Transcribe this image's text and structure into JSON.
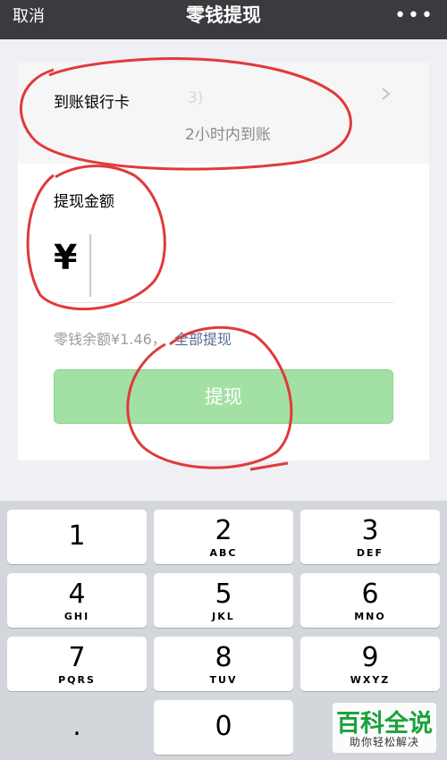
{
  "header": {
    "cancel": "取消",
    "title": "零钱提现",
    "more": "•••"
  },
  "bank": {
    "label": "到账银行卡",
    "name": "3)",
    "arrival_time": "2小时内到账"
  },
  "amount": {
    "label": "提现金额",
    "currency": "¥",
    "value": ""
  },
  "balance": {
    "text": "零钱余额¥1.46，",
    "withdraw_all": "全部提现"
  },
  "submit": {
    "label": "提现"
  },
  "keypad": {
    "keys": [
      {
        "digit": "1",
        "letters": ""
      },
      {
        "digit": "2",
        "letters": "ABC"
      },
      {
        "digit": "3",
        "letters": "DEF"
      },
      {
        "digit": "4",
        "letters": "GHI"
      },
      {
        "digit": "5",
        "letters": "JKL"
      },
      {
        "digit": "6",
        "letters": "MNO"
      },
      {
        "digit": "7",
        "letters": "PQRS"
      },
      {
        "digit": "8",
        "letters": "TUV"
      },
      {
        "digit": "9",
        "letters": "WXYZ"
      },
      {
        "digit": ".",
        "letters": ""
      },
      {
        "digit": "0",
        "letters": ""
      }
    ]
  },
  "watermark": {
    "main": "百科全说",
    "sub": "助你轻松解决"
  },
  "colors": {
    "header_bg": "#3a3a3f",
    "button_green": "#a3e0a3",
    "link_blue": "#576b95",
    "annotation_red": "#e03a3a"
  }
}
